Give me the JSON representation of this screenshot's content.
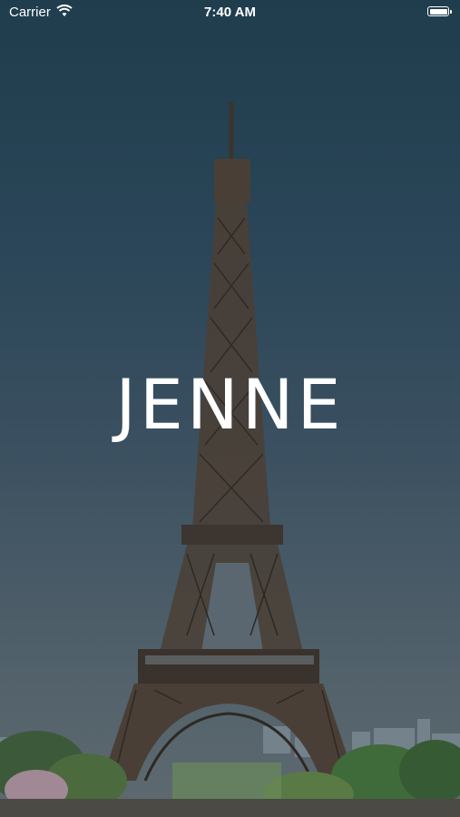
{
  "status_bar": {
    "carrier": "Carrier",
    "time": "7:40 AM",
    "wifi_icon": "wifi-icon",
    "battery_icon": "battery-icon"
  },
  "splash": {
    "logo_text": "JENNE",
    "background": "eiffel-tower-photo"
  },
  "colors": {
    "sky_top": "#1f3d4d",
    "sky_bottom": "#5f6a70",
    "tower": "#3a3430",
    "logo": "#ffffff"
  }
}
